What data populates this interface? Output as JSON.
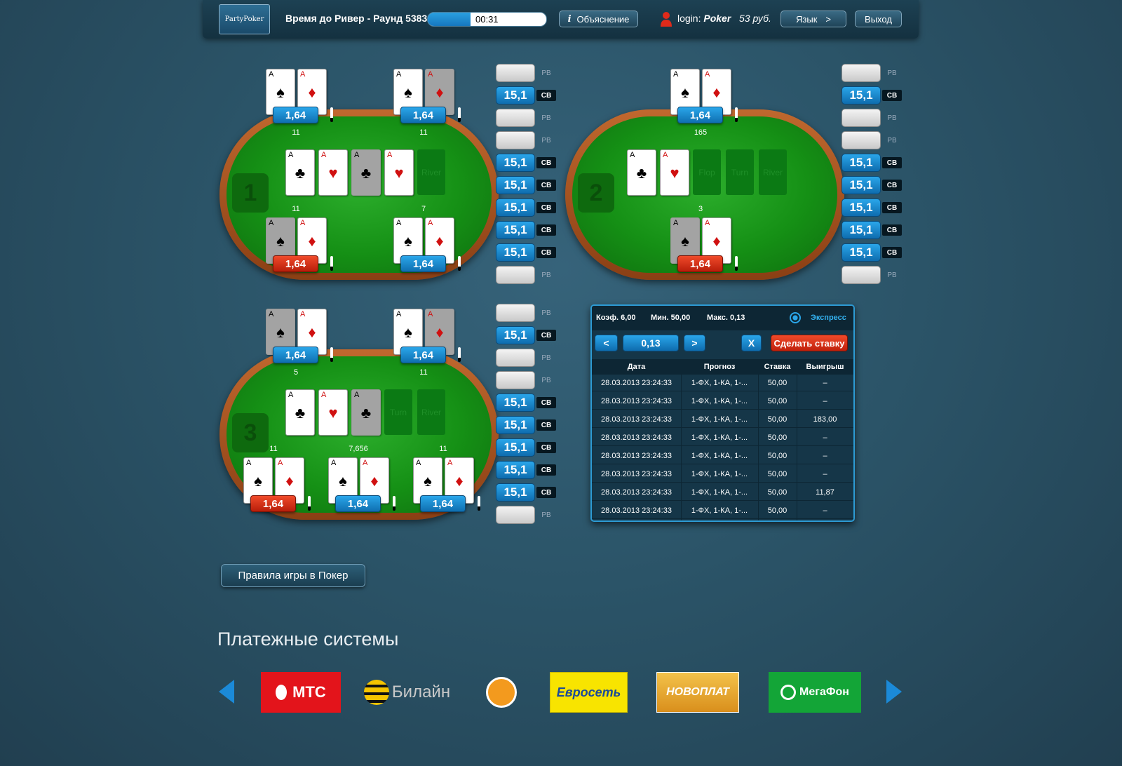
{
  "header": {
    "logo": "PartyPoker",
    "round_label": "Время до Ривер - Раунд 5383",
    "timer": "00:31",
    "timer_progress": 0.36,
    "explain": "Объяснение",
    "explain_icon": "i",
    "login_prefix": "login:",
    "login_name": "Poker",
    "balance": "53 руб.",
    "lang": "Язык",
    "lang_arrow": ">",
    "exit": "Выход"
  },
  "tables": [
    {
      "number": "1",
      "seats": [
        {
          "odd": "1,64",
          "count": "11",
          "cards": [
            "A♠",
            "A♦"
          ]
        },
        {
          "odd": "1,64",
          "count": "11",
          "cards": [
            "A♠",
            "A♦"
          ]
        },
        {
          "odd": "1,64",
          "count": "11",
          "cards": [
            "A♠",
            "A♦"
          ],
          "lose": true
        },
        {
          "odd": "1,64",
          "count": "7",
          "cards": [
            "A♠",
            "A♦"
          ]
        }
      ],
      "board": [
        "A♣",
        "A♥",
        "A♣",
        "A♥"
      ],
      "slots": [
        "River"
      ]
    },
    {
      "number": "2",
      "seats": [
        {
          "odd": "1,64",
          "count": "165",
          "cards": [
            "A♠",
            "A♦"
          ]
        },
        {
          "odd": "1,64",
          "count": "3",
          "cards": [
            "A♠",
            "A♦"
          ],
          "lose": true
        }
      ],
      "board": [
        "A♣",
        "A♥"
      ],
      "slots": [
        "Flop",
        "Turn",
        "River"
      ]
    },
    {
      "number": "3",
      "seats": [
        {
          "odd": "1,64",
          "count": "5",
          "cards": [
            "A♠",
            "A♦"
          ]
        },
        {
          "odd": "1,64",
          "count": "11",
          "cards": [
            "A♠",
            "A♦"
          ]
        },
        {
          "odd": "1,64",
          "count": "11",
          "cards": [
            "A♠",
            "A♦"
          ],
          "lose": true
        },
        {
          "odd": "1,64",
          "count": "7,656",
          "cards": [
            "A♠",
            "A♦"
          ]
        },
        {
          "odd": "1,64",
          "count": "11",
          "cards": [
            "A♠",
            "A♦"
          ]
        }
      ],
      "board": [
        "A♣",
        "A♥",
        "A♣"
      ],
      "slots": [
        "Turn",
        "River"
      ]
    }
  ],
  "bets": {
    "col1": [
      {
        "t": "РВ"
      },
      {
        "v": "15,1",
        "t": "СВ"
      },
      {
        "t": "РВ"
      },
      {
        "t": "РВ"
      },
      {
        "v": "15,1",
        "t": "СВ"
      },
      {
        "v": "15,1",
        "t": "СВ"
      },
      {
        "v": "15,1",
        "t": "СВ"
      },
      {
        "v": "15,1",
        "t": "СВ"
      },
      {
        "v": "15,1",
        "t": "СВ"
      },
      {
        "t": "РВ"
      }
    ],
    "col2": [
      {
        "t": "РВ"
      },
      {
        "v": "15,1",
        "t": "СВ"
      },
      {
        "t": "РВ"
      },
      {
        "t": "РВ"
      },
      {
        "v": "15,1",
        "t": "СВ"
      },
      {
        "v": "15,1",
        "t": "СВ"
      },
      {
        "v": "15,1",
        "t": "СВ"
      },
      {
        "v": "15,1",
        "t": "СВ"
      },
      {
        "v": "15,1",
        "t": "СВ"
      },
      {
        "t": "РВ"
      }
    ],
    "col3": [
      {
        "t": "РВ"
      },
      {
        "v": "15,1",
        "t": "СВ"
      },
      {
        "t": "РВ"
      },
      {
        "t": "РВ"
      },
      {
        "v": "15,1",
        "t": "СВ"
      },
      {
        "v": "15,1",
        "t": "СВ"
      },
      {
        "v": "15,1",
        "t": "СВ"
      },
      {
        "v": "15,1",
        "t": "СВ"
      },
      {
        "v": "15,1",
        "t": "СВ"
      },
      {
        "t": "РВ"
      }
    ]
  },
  "express": {
    "coef": "Коэф. 6,00",
    "min": "Мин. 50,00",
    "max": "Макс. 0,13",
    "label": "Экспресс",
    "prev": "<",
    "value": "0,13",
    "next": ">",
    "clear": "X",
    "bet": "Сделать ставку",
    "columns": [
      "Дата",
      "Прогноз",
      "Ставка",
      "Выигрыш"
    ],
    "rows": [
      [
        "28.03.2013 23:24:33",
        "1-ФХ, 1-КА, 1-...",
        "50,00",
        "–"
      ],
      [
        "28.03.2013 23:24:33",
        "1-ФХ, 1-КА, 1-...",
        "50,00",
        "–"
      ],
      [
        "28.03.2013 23:24:33",
        "1-ФХ, 1-КА, 1-...",
        "50,00",
        "183,00"
      ],
      [
        "28.03.2013 23:24:33",
        "1-ФХ, 1-КА, 1-...",
        "50,00",
        "–"
      ],
      [
        "28.03.2013 23:24:33",
        "1-ФХ, 1-КА, 1-...",
        "50,00",
        "–"
      ],
      [
        "28.03.2013 23:24:33",
        "1-ФХ, 1-КА, 1-...",
        "50,00",
        "–"
      ],
      [
        "28.03.2013 23:24:33",
        "1-ФХ, 1-КА, 1-...",
        "50,00",
        "11,87"
      ],
      [
        "28.03.2013 23:24:33",
        "1-ФХ, 1-КА, 1-...",
        "50,00",
        "–"
      ]
    ]
  },
  "rules": "Правила игры в Покер",
  "payments": {
    "title": "Платежные системы",
    "items": [
      {
        "name": "МТС",
        "color": "#e3141b"
      },
      {
        "name": "Билайн",
        "color": "#f5c400"
      },
      {
        "name": "",
        "color": "#f39a1e"
      },
      {
        "name": "Евросеть",
        "color": "#f8e400"
      },
      {
        "name": "НОВОПЛАТ",
        "color": "#e9ad2d"
      },
      {
        "name": "МегаФон",
        "color": "#13a537"
      }
    ]
  }
}
